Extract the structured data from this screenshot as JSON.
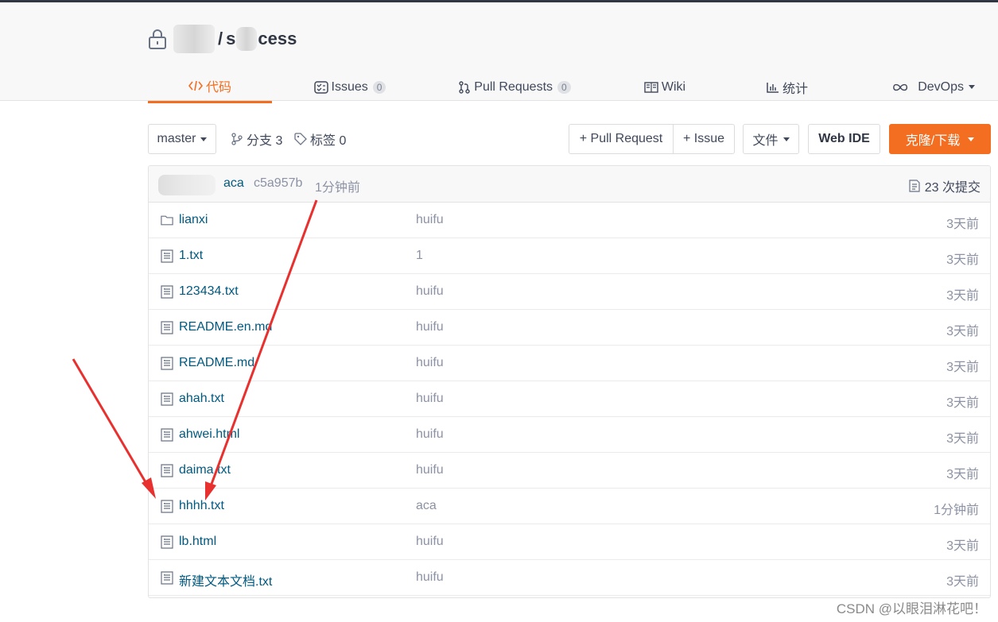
{
  "repo": {
    "separator": "/",
    "name_prefix": "s",
    "name_suffix": "cess"
  },
  "tabs": [
    {
      "label": "代码",
      "active": true
    },
    {
      "label": "Issues",
      "count": "0"
    },
    {
      "label": "Pull Requests",
      "count": "0"
    },
    {
      "label": "Wiki"
    },
    {
      "label": "统计"
    },
    {
      "label": "DevOps"
    }
  ],
  "toolbar": {
    "branch": "master",
    "branches_label": "分支 3",
    "tags_label": "标签 0",
    "pull_request_btn": "+ Pull Request",
    "issue_btn": "+ Issue",
    "file_btn": "文件",
    "webide_btn": "Web IDE",
    "clone_btn": "克隆/下载"
  },
  "commit": {
    "author": "aca",
    "hash": "c5a957b",
    "time": "1分钟前",
    "count_label": "23 次提交"
  },
  "files": [
    {
      "name": "lianxi",
      "type": "folder",
      "message": "huifu",
      "time": "3天前"
    },
    {
      "name": "1.txt",
      "type": "file",
      "message": "1",
      "time": "3天前"
    },
    {
      "name": "123434.txt",
      "type": "file",
      "message": "huifu",
      "time": "3天前"
    },
    {
      "name": "README.en.md",
      "type": "file",
      "message": "huifu",
      "time": "3天前"
    },
    {
      "name": "README.md",
      "type": "file",
      "message": "huifu",
      "time": "3天前"
    },
    {
      "name": "ahah.txt",
      "type": "file",
      "message": "huifu",
      "time": "3天前"
    },
    {
      "name": "ahwei.html",
      "type": "file",
      "message": "huifu",
      "time": "3天前"
    },
    {
      "name": "daima.txt",
      "type": "file",
      "message": "huifu",
      "time": "3天前"
    },
    {
      "name": "hhhh.txt",
      "type": "file",
      "message": "aca",
      "time": "1分钟前"
    },
    {
      "name": "lb.html",
      "type": "file",
      "message": "huifu",
      "time": "3天前"
    },
    {
      "name": "新建文本文档.txt",
      "type": "file",
      "message": "huifu",
      "time": "3天前"
    }
  ],
  "watermark": "CSDN @以眼泪淋花吧！",
  "colors": {
    "accent": "#f36e20",
    "link": "#005980",
    "muted": "#8c92a4",
    "annotation": "#e8302f"
  }
}
